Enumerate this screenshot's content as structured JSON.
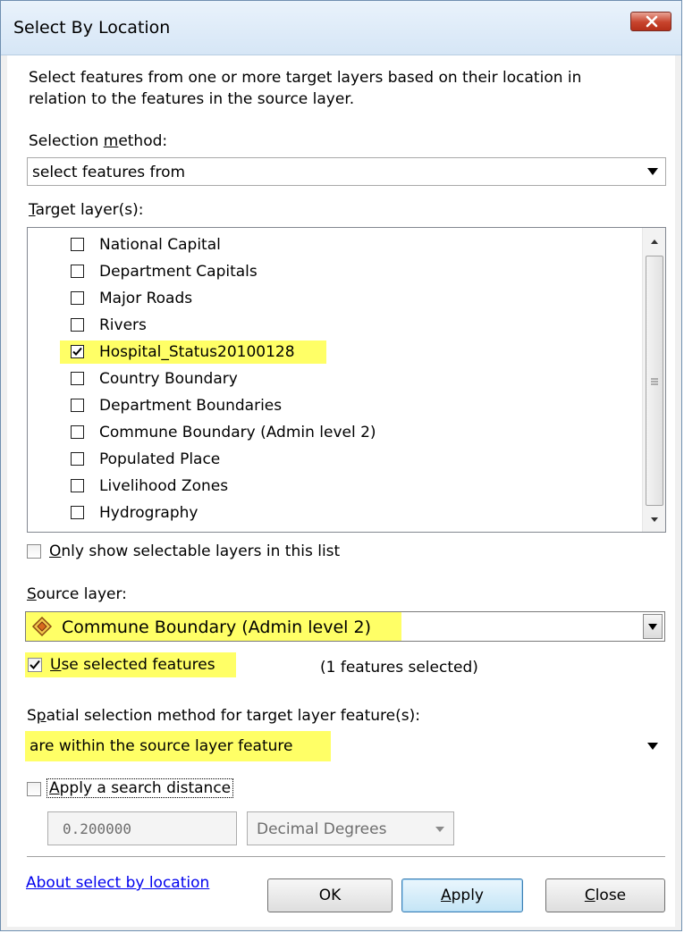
{
  "window": {
    "title": "Select By Location"
  },
  "description": "Select features from one or more target layers based on their location in relation to the features in the source layer.",
  "selection_method": {
    "label_before": "Selection ",
    "label_underline": "m",
    "label_after": "ethod:",
    "value": "select features from"
  },
  "target_layers": {
    "label_underline": "T",
    "label_after": "arget layer(s):",
    "items": [
      {
        "label": "National Capital",
        "checked": false
      },
      {
        "label": "Department Capitals",
        "checked": false
      },
      {
        "label": "Major Roads",
        "checked": false
      },
      {
        "label": "Rivers",
        "checked": false
      },
      {
        "label": "Hospital_Status20100128",
        "checked": true
      },
      {
        "label": "Country Boundary",
        "checked": false
      },
      {
        "label": "Department Boundaries",
        "checked": false
      },
      {
        "label": "Commune Boundary (Admin level 2)",
        "checked": false
      },
      {
        "label": "Populated Place",
        "checked": false
      },
      {
        "label": "Livelihood Zones",
        "checked": false
      },
      {
        "label": "Hydrography",
        "checked": false
      }
    ]
  },
  "only_selectable": {
    "label_underline": "O",
    "label_after": "nly show selectable layers in this list",
    "checked": false
  },
  "source_layer": {
    "label_underline": "S",
    "label_after": "ource layer:",
    "value": "Commune Boundary (Admin level 2)",
    "icon": "polygon-layer-icon"
  },
  "use_selected": {
    "label_underline": "U",
    "label_after": "se selected features",
    "checked": true,
    "count_text": "(1 features selected)"
  },
  "spatial_method": {
    "label_before": "S",
    "label_underline": "p",
    "label_after": "atial selection method for target layer feature(s):",
    "value": "are within the source layer feature"
  },
  "search_distance": {
    "label_underline": "A",
    "label_after": "pply a search distance",
    "checked": false,
    "distance": "0.200000",
    "units": "Decimal Degrees"
  },
  "footer": {
    "about_link": "About select by location",
    "ok": "OK",
    "apply_underline": "A",
    "apply_after": "pply",
    "close_underline": "C",
    "close_after": "lose"
  },
  "colors": {
    "highlight": "#ffff66",
    "link": "#0000ee"
  }
}
